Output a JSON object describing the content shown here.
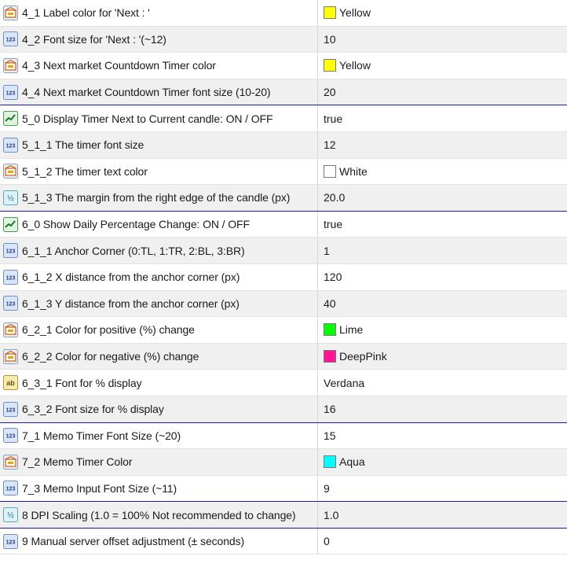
{
  "rows": [
    {
      "icon": "color-icon",
      "label": "4_1 Label color for 'Next : '",
      "value": "Yellow",
      "swatch": "#ffff00"
    },
    {
      "icon": "integer-icon",
      "label": "4_2 Font size for 'Next : '(~12)",
      "value": "10"
    },
    {
      "icon": "color-icon",
      "label": "4_3 Next market Countdown Timer color",
      "value": "Yellow",
      "swatch": "#ffff00"
    },
    {
      "icon": "integer-icon",
      "label": "4_4 Next market Countdown Timer font size (10-20)",
      "value": "20"
    },
    {
      "icon": "boolean-icon",
      "label": "5_0 Display Timer Next to Current candle: ON / OFF",
      "value": "true"
    },
    {
      "icon": "integer-icon",
      "label": "5_1_1 The timer font size",
      "value": "12"
    },
    {
      "icon": "color-icon",
      "label": "5_1_2 The timer text color",
      "value": "White",
      "swatch": "#ffffff"
    },
    {
      "icon": "double-icon",
      "label": "5_1_3 The margin from the right edge of the candle (px)",
      "value": "20.0"
    },
    {
      "icon": "boolean-icon",
      "label": "6_0 Show Daily Percentage Change: ON / OFF",
      "value": "true"
    },
    {
      "icon": "integer-icon",
      "label": "6_1_1 Anchor Corner (0:TL, 1:TR, 2:BL, 3:BR)",
      "value": "1"
    },
    {
      "icon": "integer-icon",
      "label": "6_1_2 X distance from the anchor corner (px)",
      "value": "120"
    },
    {
      "icon": "integer-icon",
      "label": "6_1_3 Y distance from the anchor corner (px)",
      "value": "40"
    },
    {
      "icon": "color-icon",
      "label": "6_2_1 Color for positive (%) change",
      "value": "Lime",
      "swatch": "#00ff00"
    },
    {
      "icon": "color-icon",
      "label": "6_2_2 Color for negative (%) change",
      "value": "DeepPink",
      "swatch": "#ff1493"
    },
    {
      "icon": "string-icon",
      "label": "6_3_1 Font for % display",
      "value": "Verdana"
    },
    {
      "icon": "integer-icon",
      "label": "6_3_2 Font size for % display",
      "value": "16"
    },
    {
      "icon": "integer-icon",
      "label": "7_1 Memo Timer Font Size (~20)",
      "value": "15"
    },
    {
      "icon": "color-icon",
      "label": "7_2 Memo Timer Color",
      "value": "Aqua",
      "swatch": "#00ffff"
    },
    {
      "icon": "integer-icon",
      "label": "7_3 Memo Input Font Size (~11)",
      "value": "9"
    },
    {
      "icon": "double-icon",
      "label": "8 DPI Scaling (1.0 = 100% Not recommended to change)",
      "value": "1.0"
    },
    {
      "icon": "integer-icon",
      "label": "9 Manual server offset adjustment (± seconds)",
      "value": "0"
    }
  ],
  "icon_glyphs": {
    "integer-icon": "123",
    "double-icon": "½",
    "string-icon": "ab"
  }
}
